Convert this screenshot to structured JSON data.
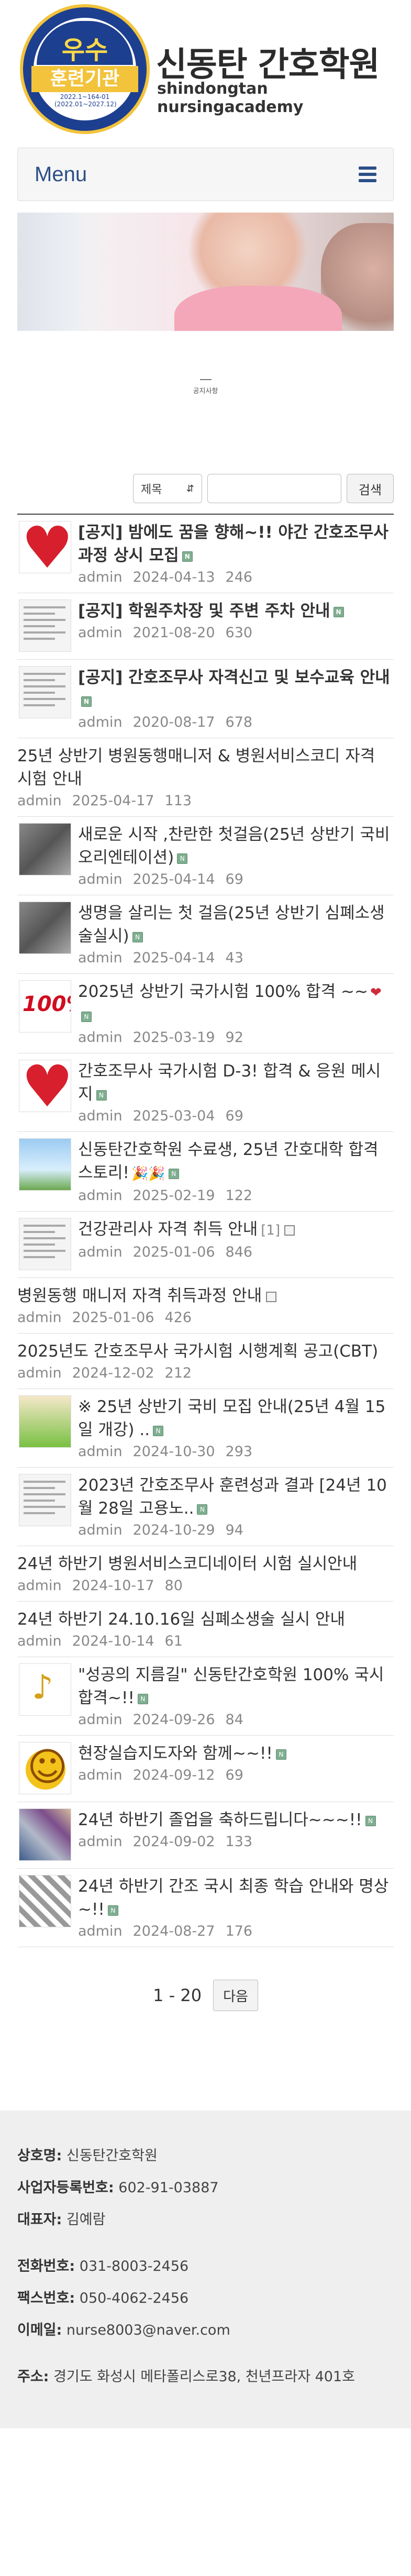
{
  "header": {
    "emblem_top": "우수",
    "emblem_mid": "훈련기관",
    "emblem_code": "2022.1~164-01\n(2022.01~2027.12)",
    "emblem_ring": "고용노동부 · 직업능력심사평가원",
    "logo_title": "신동탄 간호학원",
    "logo_sub": "shindongtan nursingacademy"
  },
  "menu": {
    "label": "Menu",
    "icon": "hamburger-icon"
  },
  "page": {
    "title": "공지사항"
  },
  "search": {
    "select_value": "제목",
    "input_value": "",
    "button_label": "검색"
  },
  "posts": [
    {
      "title": "[공지] 밤에도 꿈을 향해~!! 야간 간호조무사과정 상시 모집",
      "author": "admin",
      "date": "2024-04-13",
      "views": "246",
      "bold": true,
      "thumb": "heart",
      "badge": "new"
    },
    {
      "title": "[공지] 학원주차장 및 주변 주차 안내",
      "author": "admin",
      "date": "2021-08-20",
      "views": "630",
      "bold": true,
      "thumb": "doc",
      "badge": "new"
    },
    {
      "title": "[공지] 간호조무사 자격신고 및 보수교육 안내",
      "author": "admin",
      "date": "2020-08-17",
      "views": "678",
      "bold": true,
      "thumb": "doc",
      "badge": "new"
    },
    {
      "title": "25년 상반기 병원동행매니저 & 병원서비스코디 자격 시험 안내",
      "author": "admin",
      "date": "2025-04-17",
      "views": "113",
      "bold": false,
      "thumb": "none",
      "badge": ""
    },
    {
      "title": "새로운 시작 ,찬란한 첫걸음(25년 상반기 국비 오리엔테이션)",
      "author": "admin",
      "date": "2025-04-14",
      "views": "69",
      "bold": false,
      "thumb": "photo",
      "badge": "new"
    },
    {
      "title": "생명을 살리는 첫 걸음(25년 상반기 심폐소생술실시)",
      "author": "admin",
      "date": "2025-04-14",
      "views": "43",
      "bold": false,
      "thumb": "photo",
      "badge": "new"
    },
    {
      "title": "2025년 상반기 국가시험 100% 합격 ~~",
      "author": "admin",
      "date": "2025-03-19",
      "views": "92",
      "bold": false,
      "thumb": "100",
      "badge": "new",
      "icons": "❤"
    },
    {
      "title": "간호조무사 국가시험 D-3! 합격 & 응원 메시지",
      "author": "admin",
      "date": "2025-03-04",
      "views": "69",
      "bold": false,
      "thumb": "heart",
      "badge": "new"
    },
    {
      "title": "신동탄간호학원 수료생, 25년 간호대학 합격 스토리!",
      "author": "admin",
      "date": "2025-02-19",
      "views": "122",
      "bold": false,
      "thumb": "sky",
      "badge": "new",
      "icons": "🎉🎉"
    },
    {
      "title": "건강관리사 자격 취득 안내",
      "author": "admin",
      "date": "2025-01-06",
      "views": "846",
      "bold": false,
      "thumb": "doc",
      "badge": "file",
      "comments": "[1]"
    },
    {
      "title": "병원동행 매니저 자격 취득과정 안내",
      "author": "admin",
      "date": "2025-01-06",
      "views": "426",
      "bold": false,
      "thumb": "none",
      "badge": "file"
    },
    {
      "title": "2025년도 간호조무사 국가시험 시행계획 공고(CBT)",
      "author": "admin",
      "date": "2024-12-02",
      "views": "212",
      "bold": false,
      "thumb": "none",
      "badge": ""
    },
    {
      "title": "※ 25년 상반기 국비 모집 안내(25년 4월 15일 개강) ..",
      "author": "admin",
      "date": "2024-10-30",
      "views": "293",
      "bold": false,
      "thumb": "poster",
      "badge": "new"
    },
    {
      "title": "2023년 간호조무사 훈련성과 결과 [24년 10월 28일 고용노..",
      "author": "admin",
      "date": "2024-10-29",
      "views": "94",
      "bold": false,
      "thumb": "doc",
      "badge": "new"
    },
    {
      "title": "24년 하반기 병원서비스코디네이터 시험 실시안내",
      "author": "admin",
      "date": "2024-10-17",
      "views": "80",
      "bold": false,
      "thumb": "none",
      "badge": ""
    },
    {
      "title": "24년 하반기 24.10.16일 심폐소생술 실시 안내",
      "author": "admin",
      "date": "2024-10-14",
      "views": "61",
      "bold": false,
      "thumb": "none",
      "badge": ""
    },
    {
      "title": "\"성공의 지름길\" 신동탄간호학원 100% 국시 합격~!!",
      "author": "admin",
      "date": "2024-09-26",
      "views": "84",
      "bold": false,
      "thumb": "music",
      "badge": "new"
    },
    {
      "title": "현장실습지도자와 함께~~!!",
      "author": "admin",
      "date": "2024-09-12",
      "views": "69",
      "bold": false,
      "thumb": "smile",
      "badge": "new"
    },
    {
      "title": "24년 하반기 졸업을 축하드립니다~~~!!",
      "author": "admin",
      "date": "2024-09-02",
      "views": "133",
      "bold": false,
      "thumb": "collage",
      "badge": "new"
    },
    {
      "title": "24년 하반기 간조 국시 최종 학습 안내와 명상~!!",
      "author": "admin",
      "date": "2024-08-27",
      "views": "176",
      "bold": false,
      "thumb": "diamond",
      "badge": "new"
    }
  ],
  "pager": {
    "range": "1 - 20",
    "next_label": "다음"
  },
  "footer": {
    "company_label": "상호명:",
    "company": "신동탄간호학원",
    "bizno_label": "사업자등록번호:",
    "bizno": "602-91-03887",
    "ceo_label": "대표자:",
    "ceo": "김예람",
    "phone_label": "전화번호:",
    "phone": "031-8003-2456",
    "fax_label": "팩스번호:",
    "fax": "050-4062-2456",
    "email_label": "이메일:",
    "email": "nurse8003@naver.com",
    "address_label": "주소:",
    "address": "경기도 화성시 메타폴리스로38, 천년프라자 401호"
  },
  "colors": {
    "menu_text": "#2c4f86",
    "emblem_blue": "#1d3f8f",
    "emblem_gold": "#f2c33b",
    "heart": "#d71f2d",
    "new_badge": "#7fae90"
  }
}
